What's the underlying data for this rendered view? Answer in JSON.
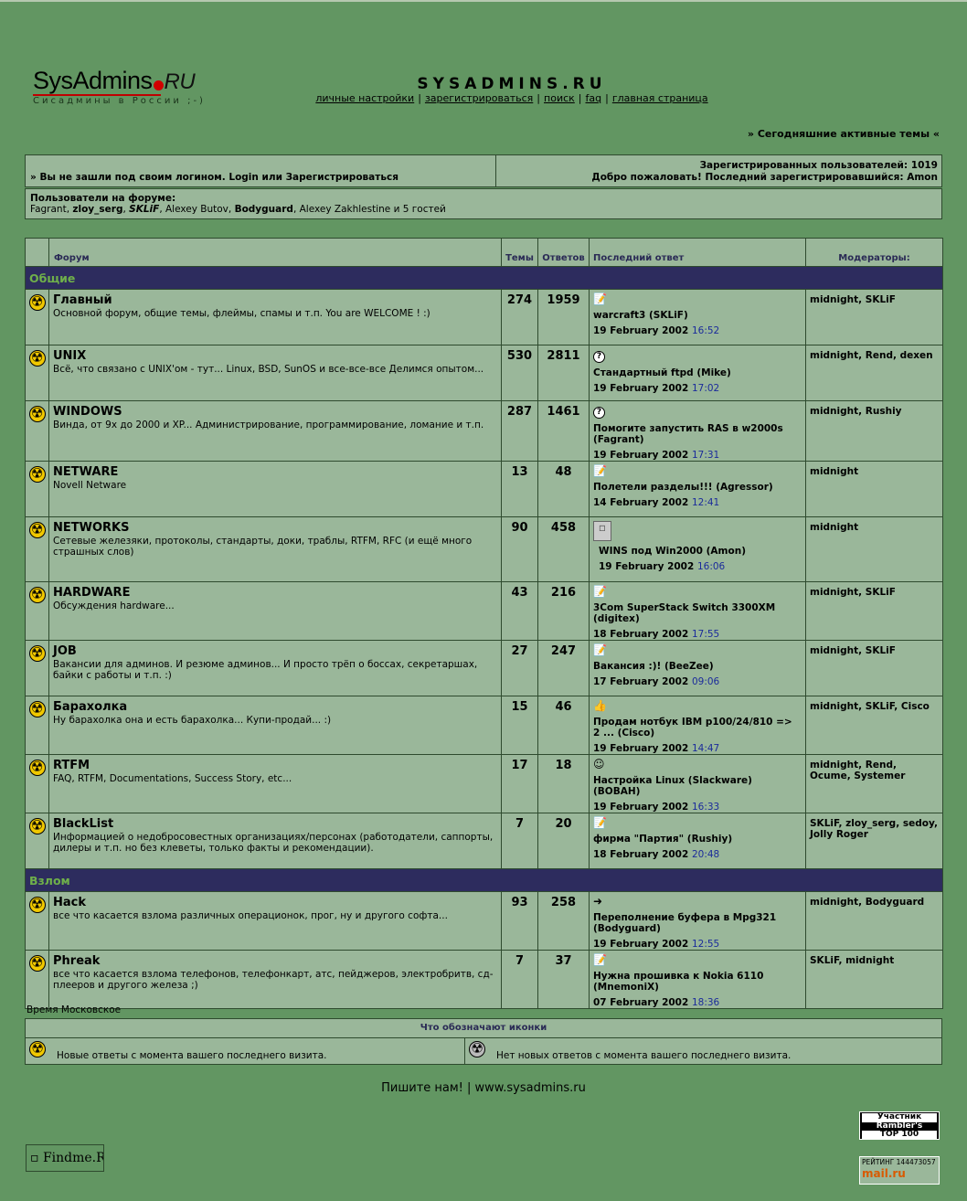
{
  "logo": {
    "brand_main": "SysAdmins",
    "brand_ru": "RU",
    "tagline": "Сисадмины в России ;-)"
  },
  "site_title": "SYSADMINS.RU",
  "top_nav": [
    "личные настройки",
    "зарегистрироваться",
    "поиск",
    "faq",
    "главная страница"
  ],
  "today_link": "» Сегодняшние активные темы «",
  "login_notice": "» Вы не зашли под своим логином. Login или Зарегистрироваться",
  "registered": "Зарегистрированных пользователей: 1019",
  "welcome": "Добро пожаловать! Последний зарегистрировавшийся: Amon",
  "online": {
    "title": "Пользователи на форуме:",
    "u1": "Fagrant, ",
    "u2": "zloy_serg",
    "u3": ", ",
    "u4": "SKLiF",
    "u5": ", Alexey Butov, ",
    "u6": "Bodyguard",
    "u7": ", Alexey Zakhlestine и 5 гостей"
  },
  "headers": {
    "forum": "Форум",
    "topics": "Темы",
    "replies": "Ответов",
    "last": "Последний ответ",
    "mods": "Модераторы:"
  },
  "categories": [
    {
      "name": "Общие",
      "forums": [
        {
          "name": "Главный",
          "desc": "Основной форум, общие темы, флеймы, спамы и т.п. You are WELCOME ! :)",
          "topics": "274",
          "replies": "1959",
          "icon": "note-icon",
          "glyph": "📝",
          "last_title": "warcraft3 (SKLiF)",
          "last_date": "19 February 2002",
          "last_time": "16:52",
          "mods": "midnight, SKLiF"
        },
        {
          "name": "UNIX",
          "desc": "Всё, что связано с UNIX'ом - тут... Linux, BSD, SunOS и все-все-все Делимся опытом...",
          "topics": "530",
          "replies": "2811",
          "icon": "question-icon",
          "glyph": "?",
          "last_title": "Стандартный ftpd (Mike)",
          "last_date": "19 February 2002",
          "last_time": "17:02",
          "mods": "midnight, Rend, dexen"
        },
        {
          "name": "WINDOWS",
          "desc": "Винда, от 9x до 2000 и XP... Администрирование, программирование, ломание и т.п.",
          "topics": "287",
          "replies": "1461",
          "icon": "question-icon",
          "glyph": "?",
          "last_title": "Помогите запустить RAS в w2000s (Fagrant)",
          "last_date": "19 February 2002",
          "last_time": "17:31",
          "mods": "midnight, Rushiy"
        },
        {
          "name": "NETWARE",
          "desc": "Novell Netware",
          "topics": "13",
          "replies": "48",
          "icon": "note-icon",
          "glyph": "📝",
          "last_title": "Полетели разделы!!! (Agressor)",
          "last_date": "14 February 2002",
          "last_time": "12:41",
          "mods": "midnight"
        },
        {
          "name": "NETWORKS",
          "desc": "Сетевые железяки, протоколы, стандарты, доки, траблы, RTFM, RFC (и ещё много страшных слов)",
          "topics": "90",
          "replies": "458",
          "icon": "broken-image-icon",
          "glyph": "▫",
          "last_title": "WINS под Win2000 (Amon)",
          "last_date": "19 February 2002",
          "last_time": "16:06",
          "mods": "midnight"
        },
        {
          "name": "HARDWARE",
          "desc": "Обсуждения hardware...",
          "topics": "43",
          "replies": "216",
          "icon": "note-icon",
          "glyph": "📝",
          "last_title": "3Com SuperStack Switch 3300XM (digitex)",
          "last_date": "18 February 2002",
          "last_time": "17:55",
          "mods": "midnight, SKLiF"
        },
        {
          "name": "JOB",
          "desc": "Вакансии для админов. И резюме админов... И просто трёп о боссах, секретаршах, байки с работы и т.п. :)",
          "topics": "27",
          "replies": "247",
          "icon": "note-icon",
          "glyph": "📝",
          "last_title": "Вакансия :)! (BeeZee)",
          "last_date": "17 February 2002",
          "last_time": "09:06",
          "mods": "midnight, SKLiF"
        },
        {
          "name": "Барахолка",
          "desc": "Ну барахолка она и есть барахолка... Купи-продай... :)",
          "topics": "15",
          "replies": "46",
          "icon": "thumbs-up-icon",
          "glyph": "👍",
          "last_title": "Продам нотбук IBM p100/24/810 => 2 ... (Cisco)",
          "last_date": "19 February 2002",
          "last_time": "14:47",
          "mods": "midnight, SKLiF, Cisco"
        },
        {
          "name": "RTFM",
          "desc": "FAQ, RTFM, Documentations, Success Story, etc...",
          "topics": "17",
          "replies": "18",
          "icon": "smiley-icon",
          "glyph": "☺",
          "last_title": "Настройка Linux (Slackware) (ВОВАН)",
          "last_date": "19 February 2002",
          "last_time": "16:33",
          "mods": "midnight, Rend, Ocume, Systemer"
        },
        {
          "name": "BlackList",
          "desc": "Информацией о недобросовестных организациях/персонах (работодатели, саппорты, дилеры и т.п. но без клеветы, только факты и рекомендации).",
          "topics": "7",
          "replies": "20",
          "icon": "note-icon",
          "glyph": "📝",
          "last_title": "фирма \"Партия\" (Rushiy)",
          "last_date": "18 February 2002",
          "last_time": "20:48",
          "mods": "SKLiF, zloy_serg, sedoy, Jolly Roger"
        }
      ]
    },
    {
      "name": "Взлом",
      "forums": [
        {
          "name": "Hack",
          "desc": "все что касается взлома различных операционок, прог, ну и другого софта...",
          "topics": "93",
          "replies": "258",
          "icon": "arrow-icon",
          "glyph": "➜",
          "last_title": "Переполнение буфера в Mpg321 (Bodyguard)",
          "last_date": "19 February 2002",
          "last_time": "12:55",
          "mods": "midnight, Bodyguard"
        },
        {
          "name": "Phreak",
          "desc": "все что касается взлома телефонов, телефонкарт, атс, пейджеров, электробритв, сд-плееров и другого железа ;)",
          "topics": "7",
          "replies": "37",
          "icon": "note-icon",
          "glyph": "📝",
          "last_title": "Нужна прошивка к Nokia 6110 (MnemoniX)",
          "last_date": "07 February 2002",
          "last_time": "18:36",
          "mods": "SKLiF, midnight"
        }
      ]
    }
  ],
  "timezone_note": "Время Московское",
  "legend": {
    "title": "Что обозначают иконки",
    "new_posts": "Новые ответы с момента вашего последнего визита.",
    "no_new_posts": "Нет новых ответов с момента вашего последнего визита."
  },
  "footer_contact": "Пишите нам! | www.sysadmins.ru",
  "badges": {
    "findme": "Findme.R",
    "rambler": [
      "Участник",
      "Rambler's",
      "TOP 100"
    ],
    "mailru_top": "РЕЙТИНГ 144473057",
    "mailru_logo": "mail.ru"
  },
  "colors": {
    "background": "#629662",
    "panel": "#9ab79a",
    "category_bar": "#2d2c5e",
    "category_text": "#6fb04a",
    "time_link": "#1b2b9b"
  }
}
